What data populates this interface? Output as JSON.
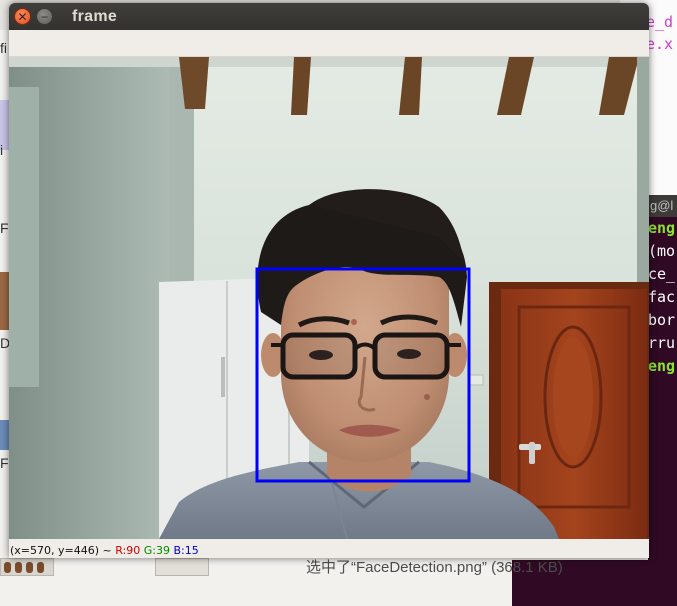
{
  "window": {
    "title": "frame"
  },
  "status_bar": {
    "coords": "(x=570, y=446) ~",
    "r": "R:90",
    "g": "G:39",
    "b": "B:15"
  },
  "background": {
    "editor_lines": [
      "e_d",
      "e.x"
    ],
    "terminal_title": "g@l",
    "terminal_lines": [
      "eng",
      "(mo",
      "ce_",
      "fac",
      "bor",
      "rru",
      "eng"
    ],
    "file_manager_fragments": [
      "fi",
      "i",
      "F",
      "De",
      "F"
    ],
    "file_manager_status": "选中了“FaceDetection.png” (368.1 KB)"
  },
  "detection": {
    "box_color": "#0000ff"
  },
  "colors": {
    "titlebar": "#3c3b37",
    "terminal_bg": "#300a24",
    "terminal_green": "#8ae234",
    "editor_magenta": "#d43bd4"
  }
}
